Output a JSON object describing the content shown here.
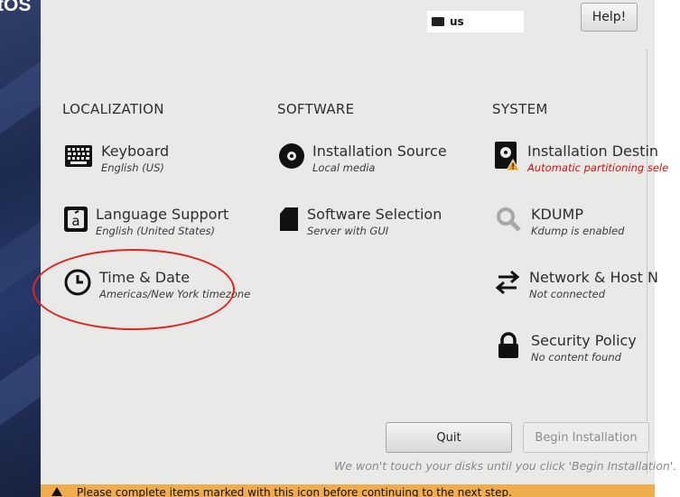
{
  "branding": {
    "logo_text": "tOS"
  },
  "header": {
    "keyboard_layout": "us",
    "help_label": "Help!"
  },
  "sections": {
    "localization": "LOCALIZATION",
    "software": "SOFTWARE",
    "system": "SYSTEM"
  },
  "spokes": {
    "keyboard": {
      "title": "Keyboard",
      "status": "English (US)"
    },
    "language": {
      "title": "Language Support",
      "status": "English (United States)"
    },
    "time_date": {
      "title": "Time & Date",
      "status": "Americas/New York timezone"
    },
    "install_source": {
      "title": "Installation Source",
      "status": "Local media"
    },
    "software_selection": {
      "title": "Software Selection",
      "status": "Server with GUI"
    },
    "install_dest": {
      "title": "Installation Destin",
      "status": "Automatic partitioning sele"
    },
    "kdump": {
      "title": "KDUMP",
      "status": "Kdump is enabled"
    },
    "network": {
      "title": "Network & Host N",
      "status": "Not connected"
    },
    "security": {
      "title": "Security Policy",
      "status": "No content found"
    }
  },
  "footer": {
    "quit_label": "Quit",
    "begin_label": "Begin Installation",
    "note": "We won't touch your disks until you click 'Begin Installation'.",
    "warning": "Please complete items marked with this icon before continuing to the next step."
  },
  "colors": {
    "warning_text": "#d0140f",
    "warning_bar": "#f0ad4e",
    "annotation_circle": "#e0231c"
  }
}
